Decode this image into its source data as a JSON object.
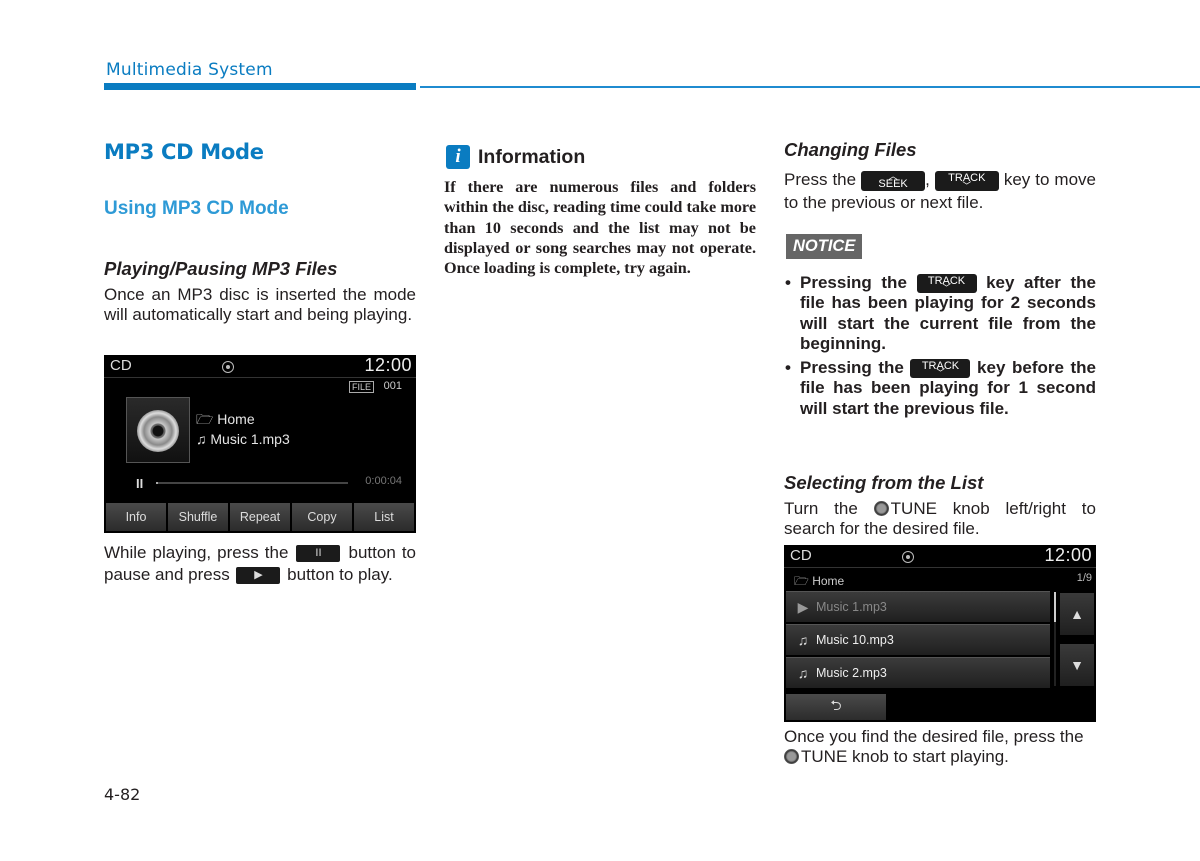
{
  "header": {
    "section_title": "Multimedia System",
    "accent_color": "#0a7cc1"
  },
  "left_column": {
    "title": "MP3 CD Mode",
    "subtitle": "Using MP3 CD Mode",
    "playing_heading": "Playing/Pausing MP3 Files",
    "playing_text": "Once an MP3 disc is inserted the mode will automatically start and being playing.",
    "screen": {
      "source": "CD",
      "status_icon": "disc-icon",
      "clock": "12:00",
      "file_badge": "FILE",
      "file_number": "001",
      "folder_icon": "folder-icon",
      "folder": "Home",
      "track_icon": "music-note-icon",
      "track": "Music 1.mp3",
      "play_state_icon": "pause-icon",
      "elapsed": "0:00:04",
      "progress_fraction": 0.01,
      "buttons": [
        "Info",
        "Shuffle",
        "Repeat",
        "Copy",
        "List"
      ]
    },
    "pause_text": {
      "part1": "While playing, press the",
      "part2": "button to pause and press",
      "part3": "button to play.",
      "pause_key_glyph": "II",
      "play_key_glyph": "▶"
    }
  },
  "middle_column": {
    "info_icon_glyph": "i",
    "info_title": "Information",
    "info_text": "If there are numerous files and folders within the disc, reading time could take more than 10 seconds and the list may not be displayed or song searches may not operate. Once loading is complete, try again."
  },
  "right_column": {
    "changing_heading": "Changing Files",
    "changing_text": {
      "part1": "Press the",
      "sep": ",",
      "part2": "key to move to the previous or next file."
    },
    "keys": {
      "seek_label": "SEEK",
      "seek_arrow": "^",
      "track_label": "TRACK",
      "track_arrow": "v"
    },
    "notice_label": "NOTICE",
    "notices": [
      {
        "before": "Pressing the",
        "after": "key after the file has been playing for 2 seconds will start the current file from the beginning."
      },
      {
        "before": "Pressing the",
        "after": "key before the file has been playing for 1 second will start the previous file."
      }
    ],
    "selecting_heading": "Selecting from the List",
    "selecting_text": {
      "part1": "Turn the",
      "knob_label": "TUNE",
      "part2": "knob left/right to search for the desired file."
    },
    "list_screen": {
      "source": "CD",
      "clock": "12:00",
      "folder": "Home",
      "count": "1/9",
      "items": [
        {
          "icon": "play-circle-icon",
          "glyph": "▶",
          "label": "Music 1.mp3",
          "active": true
        },
        {
          "icon": "music-note-icon",
          "glyph": "♫",
          "label": "Music 10.mp3",
          "active": false
        },
        {
          "icon": "music-note-icon",
          "glyph": "♫",
          "label": "Music 2.mp3",
          "active": false
        }
      ],
      "up_glyph": "▲",
      "down_glyph": "▼",
      "back_glyph": "⮌"
    },
    "final_text": {
      "part1": "Once you find the desired file, press the",
      "knob_label": "TUNE",
      "part2": "knob to start playing."
    }
  },
  "footer": {
    "page_number": "4-82"
  }
}
